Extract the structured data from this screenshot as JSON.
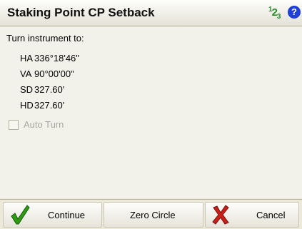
{
  "window": {
    "title": "Staking Point CP Setback"
  },
  "icons": {
    "numeric": "numeric-keypad-icon",
    "help": "help-icon"
  },
  "content": {
    "instruction": "Turn instrument to:",
    "readings": [
      {
        "label": "HA",
        "value": "336°18'46\""
      },
      {
        "label": "VA",
        "value": "90°00'00\""
      },
      {
        "label": "SD",
        "value": "327.60'"
      },
      {
        "label": "HD",
        "value": "327.60'"
      }
    ],
    "auto_turn": {
      "label": "Auto Turn",
      "checked": false,
      "enabled": false
    }
  },
  "buttons": {
    "continue": "Continue",
    "zero_circle": "Zero Circle",
    "cancel": "Cancel"
  },
  "colors": {
    "check": "#2f9a12",
    "cross": "#c8201b",
    "help": "#1f3fd8",
    "numeric": "#2a8a2a"
  }
}
